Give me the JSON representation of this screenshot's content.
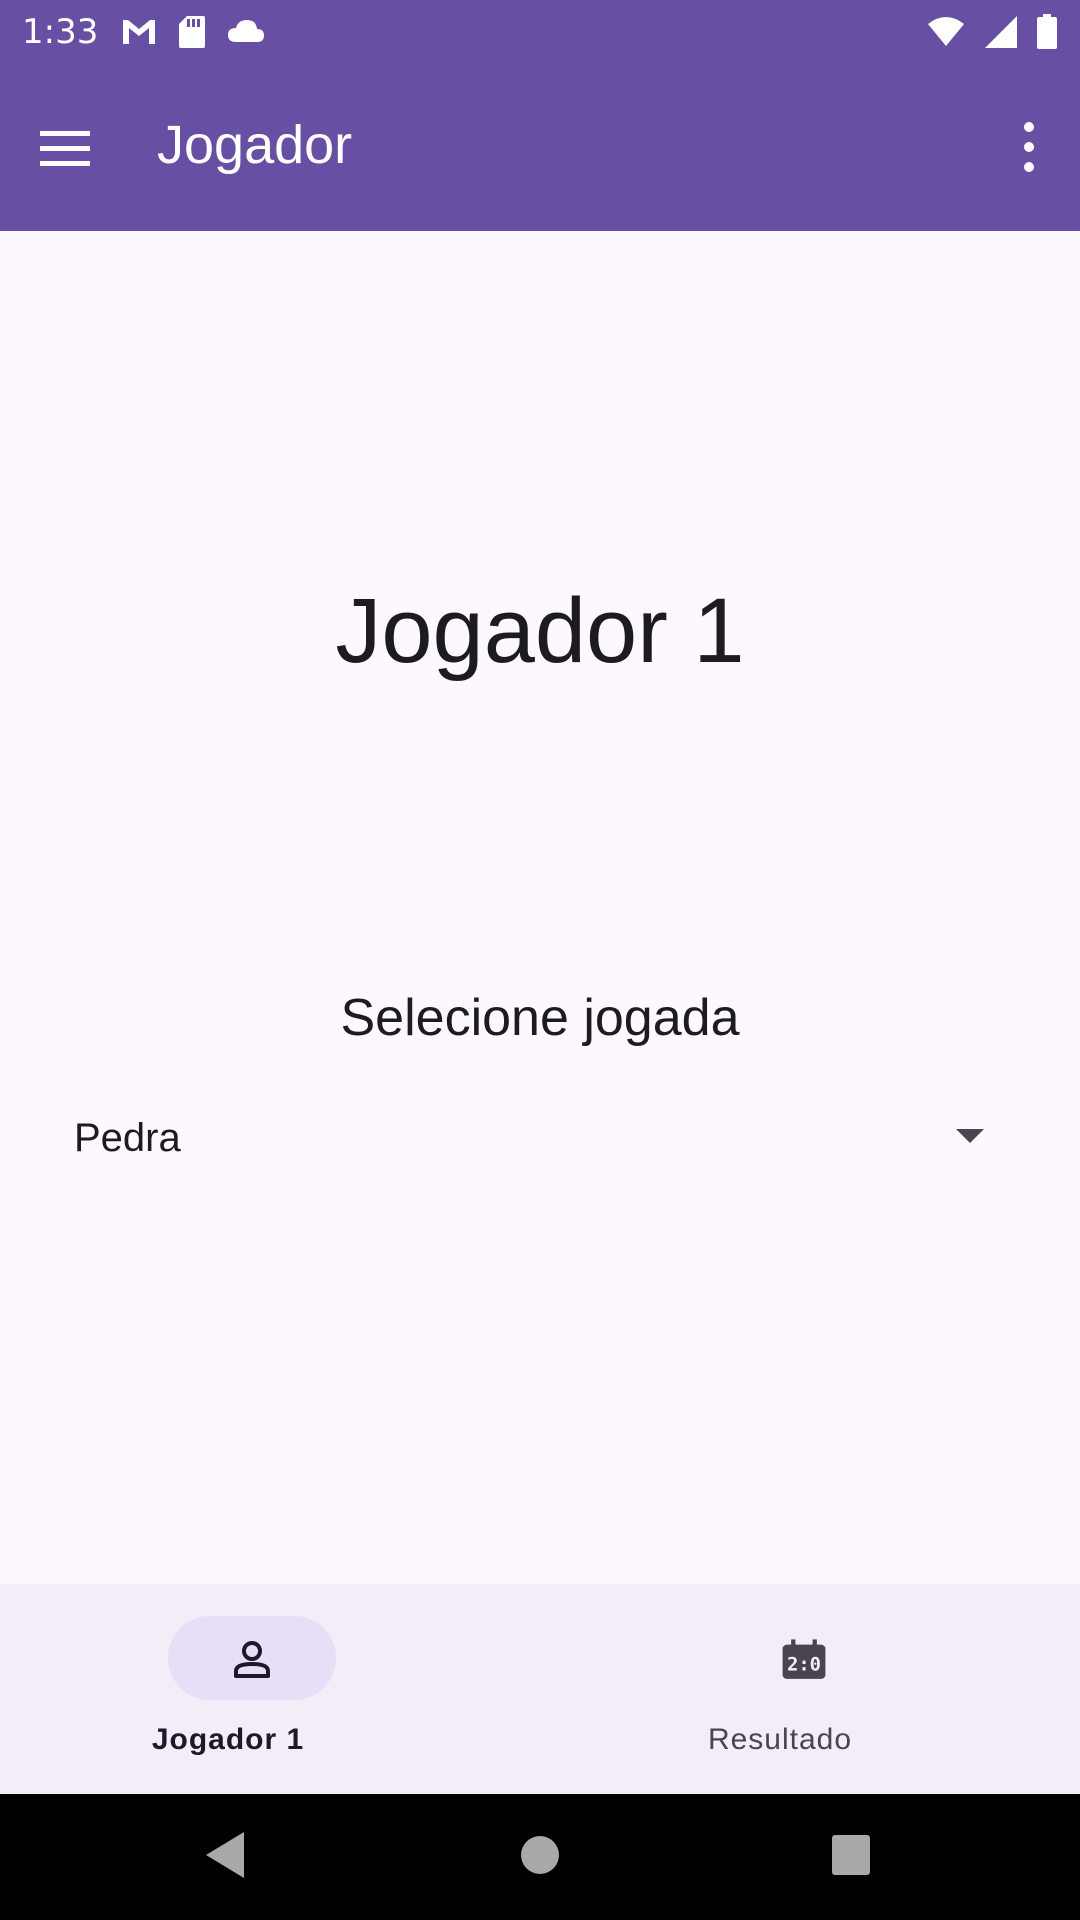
{
  "status_bar": {
    "time": "1:33",
    "left_icons": [
      "gmail-icon",
      "sd-card-icon",
      "cloud-icon"
    ],
    "right_icons": [
      "wifi-icon",
      "signal-icon",
      "battery-icon"
    ]
  },
  "app_bar": {
    "title": "Jogador",
    "menu_icon": "hamburger-menu-icon",
    "overflow_icon": "more-vert-icon"
  },
  "main": {
    "player_title": "Jogador 1",
    "select_label": "Selecione jogada",
    "dropdown": {
      "selected": "Pedra"
    }
  },
  "bottom_nav": {
    "items": [
      {
        "label": "Jogador 1",
        "icon": "person-icon",
        "selected": true
      },
      {
        "label": "Resultado",
        "icon": "scoreboard-icon",
        "selected": false
      }
    ]
  },
  "system_nav": {
    "buttons": [
      "back-icon",
      "home-icon",
      "recents-icon"
    ]
  },
  "colors": {
    "primary": "#6750A4",
    "background": "#FDF7FF",
    "nav_background": "#F3EDF7",
    "nav_indicator": "#E8DEF8"
  }
}
